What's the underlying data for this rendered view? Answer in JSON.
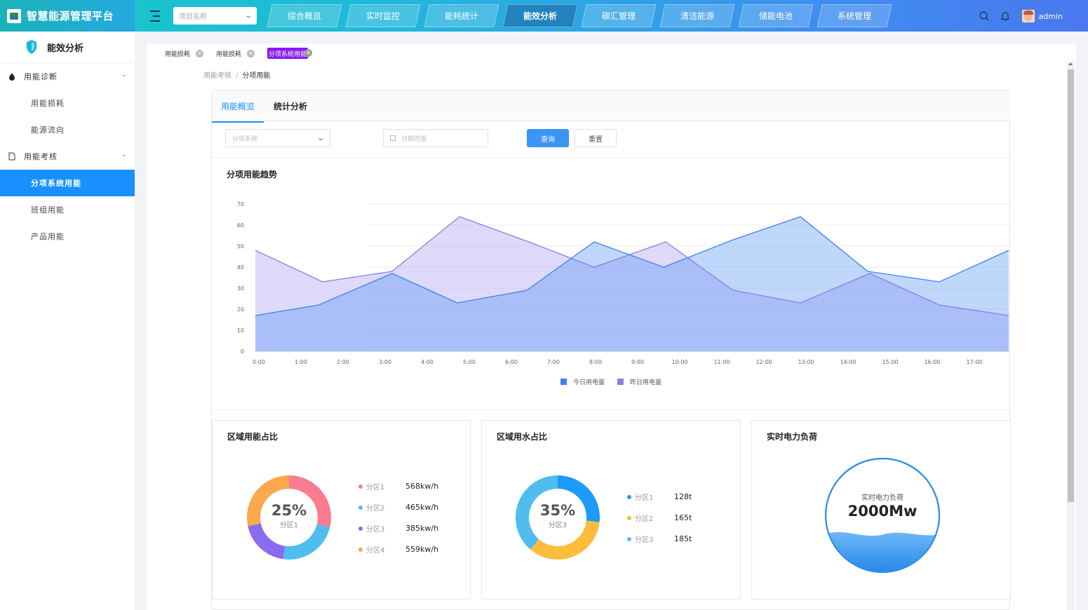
{
  "app": {
    "title": "智慧能源管理平台"
  },
  "header": {
    "project_placeholder": "项目名称",
    "nav": [
      {
        "label": "综合概览"
      },
      {
        "label": "实时监控"
      },
      {
        "label": "能耗统计"
      },
      {
        "label": "能效分析",
        "active": true
      },
      {
        "label": "碳汇管理"
      },
      {
        "label": "清洁能源"
      },
      {
        "label": "储能电池"
      },
      {
        "label": "系统管理"
      }
    ],
    "username": "admin"
  },
  "sidebar": {
    "title": "能效分析",
    "groups": [
      {
        "label": "用能诊断",
        "icon": "drop-icon",
        "items": [
          "用能损耗",
          "能源流向"
        ]
      },
      {
        "label": "用能考核",
        "icon": "document-icon",
        "items": [
          "分项系统用能",
          "班组用能",
          "产品用能"
        ]
      }
    ],
    "active_item": "分项系统用能"
  },
  "tags": [
    {
      "label": "用能损耗"
    },
    {
      "label": "用能损耗"
    },
    {
      "label": "分项系统用能",
      "active": true
    }
  ],
  "breadcrumb": {
    "parent": "用能考核",
    "separator": "/",
    "current": "分项用能"
  },
  "tabs": [
    {
      "label": "用能概览",
      "active": true
    },
    {
      "label": "统计分析"
    }
  ],
  "filters": {
    "system_placeholder": "分项系统",
    "date_placeholder": "日期范围",
    "query_label": "查询",
    "reset_label": "重置"
  },
  "trend": {
    "title": "分项用能趋势"
  },
  "chart_data": [
    {
      "type": "area",
      "title": "分项用能趋势",
      "x": [
        "0:00",
        "1:00",
        "2:00",
        "3:00",
        "4:00",
        "5:00",
        "6:00",
        "7:00",
        "8:00",
        "9:00",
        "10:00",
        "11:00",
        "12:00",
        "13:00",
        "14:00",
        "15:00",
        "16:00",
        "17:00"
      ],
      "ylim": [
        0,
        70
      ],
      "yticks": [
        0,
        10,
        20,
        30,
        40,
        50,
        60,
        70
      ],
      "grid": true,
      "legend": "bottom",
      "series": [
        {
          "name": "今日用电量",
          "color": "#3b82f6",
          "points": [
            [
              0,
              17
            ],
            [
              1.5,
              22
            ],
            [
              3.25,
              37
            ],
            [
              4.8,
              23
            ],
            [
              6.45,
              29
            ],
            [
              8.05,
              52
            ],
            [
              9.7,
              40
            ],
            [
              11.35,
              53
            ],
            [
              12.95,
              64
            ],
            [
              14.55,
              38
            ],
            [
              16.25,
              33
            ],
            [
              17.9,
              48
            ]
          ]
        },
        {
          "name": "昨日用电量",
          "color": "#8b7be8",
          "points": [
            [
              0,
              48
            ],
            [
              1.6,
              33
            ],
            [
              3.25,
              38
            ],
            [
              4.85,
              64
            ],
            [
              6.5,
              52
            ],
            [
              8.05,
              40
            ],
            [
              9.75,
              52
            ],
            [
              11.35,
              29
            ],
            [
              12.95,
              23
            ],
            [
              14.6,
              37
            ],
            [
              16.25,
              22
            ],
            [
              17.9,
              17
            ]
          ]
        }
      ]
    },
    {
      "type": "pie",
      "title": "区域用能占比",
      "center_value": "25%",
      "center_label": "分区1",
      "slices": [
        {
          "name": "分区1",
          "value": 568,
          "display": "568kw/h",
          "color": "#fb7b8f"
        },
        {
          "name": "分区2",
          "value": 465,
          "display": "465kw/h",
          "color": "#4fbdf0"
        },
        {
          "name": "分区3",
          "value": 385,
          "display": "385kw/h",
          "color": "#8b6cf0"
        },
        {
          "name": "分区4",
          "value": 559,
          "display": "559kw/h",
          "color": "#fba84c"
        }
      ]
    },
    {
      "type": "pie",
      "title": "区域用水占比",
      "center_value": "35%",
      "center_label": "分区3",
      "slices": [
        {
          "name": "分区1",
          "value": 128,
          "display": "128t",
          "color": "#1e9af8"
        },
        {
          "name": "分区2",
          "value": 165,
          "display": "165t",
          "color": "#fcbc3c"
        },
        {
          "name": "分区3",
          "value": 185,
          "display": "185t",
          "color": "#4fbdf0"
        }
      ]
    }
  ],
  "load": {
    "title": "实时电力负荷",
    "label": "实时电力负荷",
    "value": "2000Mw"
  }
}
